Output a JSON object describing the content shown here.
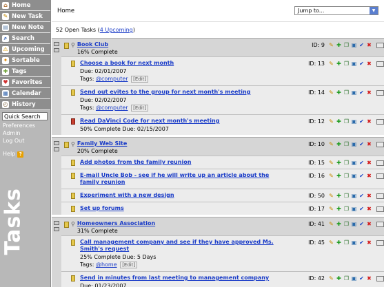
{
  "sidebar": {
    "nav": [
      {
        "label": "Home",
        "icon": "home-icon",
        "glyph": "⌂",
        "color": "#b07030"
      },
      {
        "label": "New Task",
        "icon": "new-task-icon",
        "glyph": "✎",
        "color": "#c48a00"
      },
      {
        "label": "New Note",
        "icon": "new-note-icon",
        "glyph": "▤",
        "color": "#6a8ab0"
      },
      {
        "label": "Search",
        "icon": "search-icon",
        "glyph": "⌕",
        "color": "#2a5ab0"
      },
      {
        "label": "Upcoming",
        "icon": "upcoming-icon",
        "glyph": "⚠",
        "color": "#e0a000"
      },
      {
        "label": "Sortable",
        "icon": "sortable-icon",
        "glyph": "✦",
        "color": "#e08a00"
      },
      {
        "label": "Tags",
        "icon": "tags-icon",
        "glyph": "✚",
        "color": "#6aa030"
      },
      {
        "label": "Favorites",
        "icon": "favorites-icon",
        "glyph": "♥",
        "color": "#d03030"
      },
      {
        "label": "Calendar",
        "icon": "calendar-icon",
        "glyph": "▦",
        "color": "#3a6ab0"
      },
      {
        "label": "History",
        "icon": "history-icon",
        "glyph": "◴",
        "color": "#7a5a30"
      }
    ],
    "quick_search": "Quick Search",
    "links": [
      "Preferences",
      "Admin",
      "Log Out"
    ],
    "help": "Help",
    "brand": "Tasks"
  },
  "header": {
    "breadcrumb": "Home",
    "jump_to": "Jump to..."
  },
  "summary": {
    "count_text": "52 Open Tasks (",
    "upcoming_link": "4 Upcoming",
    "close_paren": ")"
  },
  "projects": [
    {
      "title": "Book Club",
      "status": "16% Complete",
      "id": "ID: 9",
      "tasks": [
        {
          "title": "Choose a book for next month",
          "line": "Due: 02/01/2007",
          "tags_label": "Tags:",
          "tag": "@computer",
          "edit": "Edit",
          "id": "ID: 13",
          "red": false
        },
        {
          "title": "Send out evites to the group for next month's meeting",
          "line": "Due: 02/02/2007",
          "tags_label": "Tags:",
          "tag": "@computer",
          "edit": "Edit",
          "id": "ID: 14",
          "red": false
        },
        {
          "title": "Read DaVinci Code for next month's meeting",
          "line": "50% Complete   Due: 02/15/2007",
          "id": "ID: 12",
          "red": true
        }
      ]
    },
    {
      "title": "Family Web Site",
      "status": "20% Complete",
      "id": "ID: 10",
      "tasks": [
        {
          "title": "Add photos from the family reunion",
          "id": "ID: 15",
          "red": false
        },
        {
          "title": "E-mail Uncle Bob - see if he will write up an article about the family reunion",
          "id": "ID: 16",
          "red": false
        },
        {
          "title": "Experiment with a new design",
          "id": "ID: 50",
          "red": false
        },
        {
          "title": "Set up forums",
          "id": "ID: 17",
          "red": false
        }
      ]
    },
    {
      "title": "Homeowners Association",
      "status": "31% Complete",
      "id": "ID: 41",
      "tasks": [
        {
          "title": "Call management company and see if they have approved Ms. Smith's request",
          "line": "25% Complete   Due: 5 Days",
          "tags_label": "Tags:",
          "tag": "@home",
          "edit": "Edit",
          "id": "ID: 45",
          "red": false
        },
        {
          "title": "Send in minutes from last meeting to management company",
          "line": "Due: 01/23/2007",
          "id": "ID: 42",
          "red": false
        }
      ]
    }
  ],
  "colors": {
    "link": "#1a3cc8",
    "sidebar": "#8e8e8e",
    "project_bg": "#d6d6d6",
    "task_bg": "#ececec"
  }
}
